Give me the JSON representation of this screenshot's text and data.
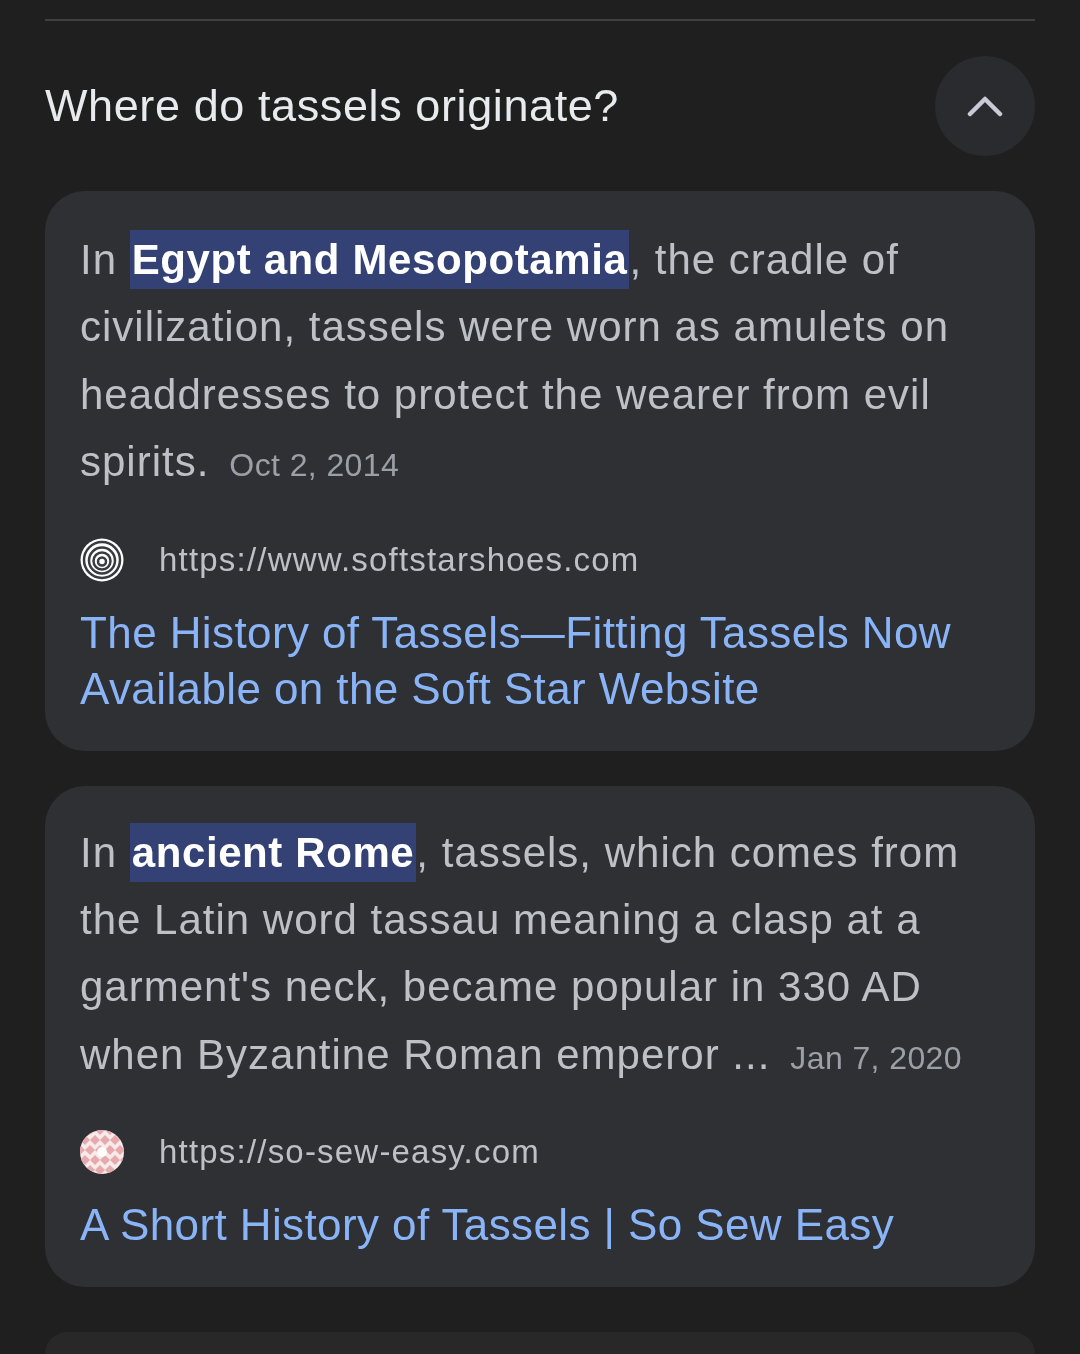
{
  "question": {
    "text": "Where do tassels originate?",
    "expanded": true
  },
  "results": [
    {
      "snippet": "In **Egypt and Mesopotamia**, the cradle of civilization, tassels were worn as amulets on headdresses to protect the wearer from evil spirits.",
      "date": "Oct 2, 2014",
      "favicon": {
        "kind": "rings"
      },
      "url": "https://www.softstarshoes.com",
      "title": "The History of Tassels—Fitting Tassels Now Available on the Soft Star Website"
    },
    {
      "snippet": "In **ancient Rome**, tassels, which comes from the Latin word tassau meaning a clasp at a garment's neck, became popular in 330 AD when Byzantine Roman emperor ...",
      "date": "Jan 7, 2020",
      "favicon": {
        "kind": "pattern"
      },
      "url": "https://so-sew-easy.com",
      "title": "A Short History of Tassels | So Sew Easy"
    }
  ]
}
